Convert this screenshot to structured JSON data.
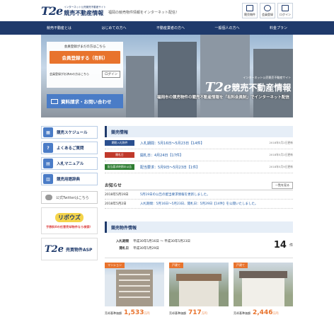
{
  "header": {
    "logo_mark": "T2e",
    "logo_sub": "インターネット公売競売不動産サイト",
    "logo_name": "競売不動産情報",
    "tagline": "福岡の競売物件情報をインターネット配信！",
    "icons": [
      {
        "icon": "building-icon",
        "label": "競売物件"
      },
      {
        "icon": "person-icon",
        "label": "会員登録"
      },
      {
        "icon": "login-icon",
        "label": "ログイン"
      }
    ]
  },
  "nav": [
    "競売不動産とは",
    "はじめての方へ",
    "不動産業者の方へ",
    "一般個人の方へ",
    "料金プラン"
  ],
  "hero": {
    "panel_label": "会員登録がまだの方はこちら",
    "register_button": "会員登録する（有料）",
    "login_label": "会員登録がお済みの方はこちら",
    "login_button": "ログイン",
    "contact_button": "資料請求・お問い合わせ",
    "brand_sub": "インターネット公売競売不動産サイト",
    "brand_mark": "T2e",
    "brand_name": "競売不動産情報",
    "description": "福岡市の競売物件の競売不動産情報を「有料会員制」でインターネット配信"
  },
  "sidebar": {
    "items": [
      {
        "icon": "calendar-icon",
        "label": "競売スケジュール"
      },
      {
        "icon": "question-icon",
        "label": "よくあるご質問"
      },
      {
        "icon": "book-icon",
        "label": "入札マニュアル"
      },
      {
        "icon": "dictionary-icon",
        "label": "競売用語辞典"
      }
    ],
    "twitter": "公式Twitterはこちら",
    "banner1_logo": "リボウズ",
    "banner1_caption": "手数料0の任意売却物件なら検索！",
    "banner2_mark": "T2e",
    "banner2_text": "売買物件ASP"
  },
  "news": {
    "title": "競売情報",
    "rows": [
      {
        "tag": "期間入札物件",
        "tag_color": "#2a4f8f",
        "text": "入札期間：5月16日〜5月23日【14件】",
        "date": "2018年5月2日更新"
      },
      {
        "tag": "開札日",
        "tag_color": "#c0392b",
        "text": "開札日：4月24日【17件】",
        "date": "2018年5月2日更新"
      },
      {
        "tag": "配当要求終期の公告",
        "tag_color": "#2e7d32",
        "text": "配当要求：5月9日〜5月23日【1件】",
        "date": "2018年5月9日更新"
      }
    ]
  },
  "notice": {
    "title": "お知らせ",
    "more": "一覧を見る",
    "rows": [
      {
        "date": "2018年5月19日",
        "text": "5月19日の公告の配当要求情報を更新しました。"
      },
      {
        "date": "2018年5月2日",
        "text": "入札期間：5月16日〜5月23日、開札日：5月29日【14件】を公開いたしました。"
      }
    ]
  },
  "properties": {
    "title": "競売物件情報",
    "label_period": "入札期間",
    "label_open": "開札日",
    "period": "平成30年5月16日 〜 平成30年5月23日",
    "open": "平成30年5月29日",
    "count": "14",
    "count_unit": "件",
    "cards": [
      {
        "tag": "マンション",
        "price_label": "売却基準価額",
        "price": "1,533",
        "unit": "万円"
      },
      {
        "tag": "戸建て",
        "price_label": "売却基準価額",
        "price": "717",
        "unit": "万円"
      },
      {
        "tag": "戸建て",
        "price_label": "売却基準価額",
        "price": "2,446",
        "unit": "万円"
      }
    ]
  },
  "colors": {
    "navy": "#1f3a6b",
    "orange": "#e8732d",
    "blue": "#4a7cc7"
  }
}
